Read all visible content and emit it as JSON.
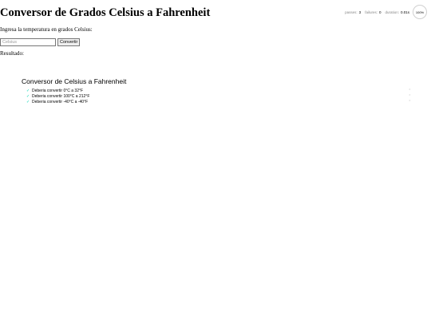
{
  "page": {
    "title": "Conversor de Grados Celsius a Fahrenheit",
    "prompt": "Ingresa la temperatura en grados Celsius:",
    "input_placeholder": "Celsius",
    "convert_label": "Convertir",
    "result_label": "Resultado:"
  },
  "stats": {
    "passes_label": "passes:",
    "passes": "3",
    "failures_label": "failures:",
    "failures": "0",
    "duration_label": "duration:",
    "duration": "0.01s",
    "progress": "100%"
  },
  "suite": {
    "title": "Conversor de Celsius a Fahrenheit",
    "tests": [
      {
        "label": "Deberia convertir 0°C a 32°F",
        "status_icon": "✓",
        "replay_icon": "‣"
      },
      {
        "label": "Deberia convertir 100°C a 212°F",
        "status_icon": "✓",
        "replay_icon": "‣"
      },
      {
        "label": "Deberia convertir -40°C a -40°F",
        "status_icon": "✓",
        "replay_icon": "‣"
      }
    ]
  },
  "colors": {
    "pass": "#00d6b2",
    "muted": "#888888"
  }
}
